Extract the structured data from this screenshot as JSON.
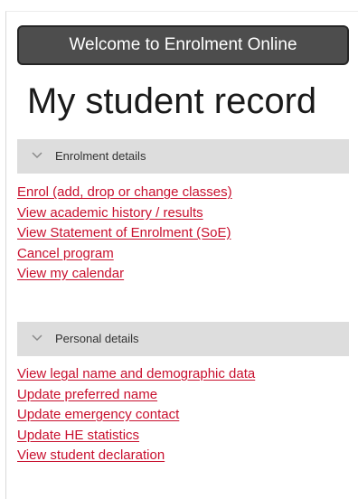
{
  "welcome": {
    "label": "Welcome to Enrolment Online"
  },
  "page_title": "My student record",
  "sections": [
    {
      "header": "Enrolment details",
      "icon": "chevron-down-icon",
      "links": [
        "Enrol (add, drop or change classes)",
        "View academic history / results",
        "View Statement of Enrolment (SoE)",
        "Cancel program",
        "View my calendar"
      ]
    },
    {
      "header": "Personal details",
      "icon": "chevron-down-icon",
      "links": [
        "View legal name and demographic data",
        "Update preferred name",
        "Update emergency contact",
        "Update HE statistics",
        "View student declaration"
      ]
    }
  ],
  "colors": {
    "link": "#c8102e",
    "header_bg": "#dddddd",
    "button_bg": "#4d4d4d"
  }
}
